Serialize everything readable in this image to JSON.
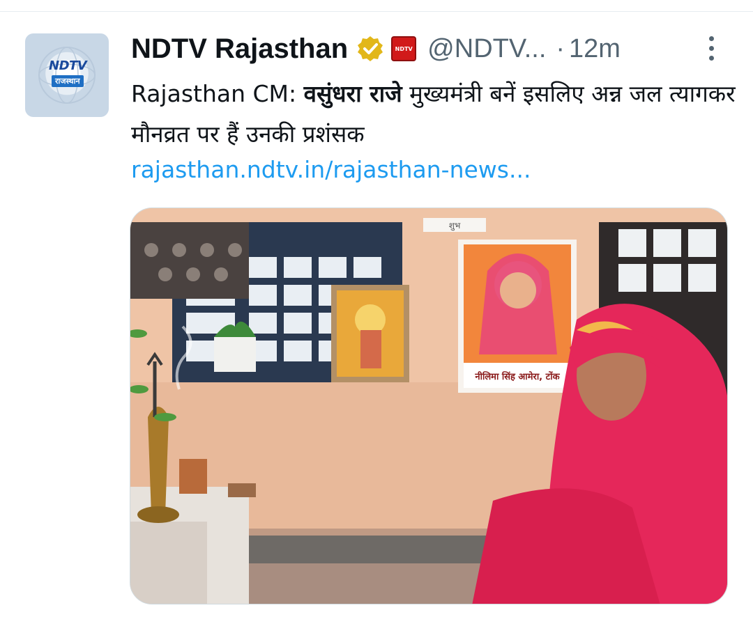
{
  "tweet": {
    "display_name": "NDTV Rajasthan",
    "handle": "@NDTV...",
    "separator": "·",
    "time": "12m",
    "org_badge_text": "NDTV",
    "text_prefix": "Rajasthan CM: ",
    "text_bold": "वसुंधरा राजे",
    "text_rest": " मुख्यमंत्री बनें इसलिए अन्न जल त्यागकर मौनव्रत पर हैं उनकी प्रशंसक",
    "link": "rajasthan.ndtv.in/rajasthan-news..."
  },
  "avatar": {
    "logo_text": "NDTV",
    "logo_sub": "राजस्थान"
  },
  "media": {
    "poster_caption": "नीलिमा सिंह आमेरा, टोंक",
    "wall_sign": "शुभ",
    "description_icon": "photo"
  },
  "colors": {
    "text_primary": "#0f1419",
    "text_secondary": "#536471",
    "link": "#1d9bf0",
    "verified_badge": "#e2b719",
    "org_badge": "#d11a1a"
  }
}
